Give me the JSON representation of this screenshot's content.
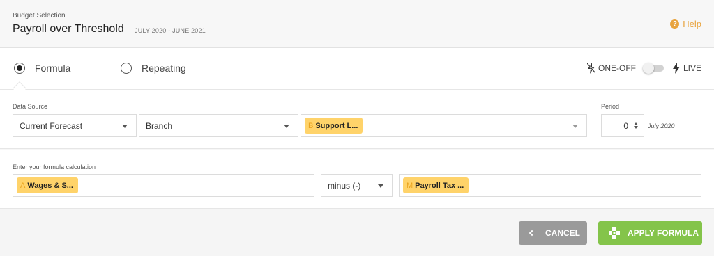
{
  "header": {
    "eyebrow": "Budget Selection",
    "title": "Payroll over Threshold",
    "subtitle": "JULY 2020 - JUNE 2021",
    "help_label": "Help",
    "help_icon": "question-circle-icon"
  },
  "modes": {
    "formula_label": "Formula",
    "repeating_label": "Repeating",
    "selected": "Formula"
  },
  "live_toggle": {
    "one_off_label": "ONE-OFF",
    "live_label": "LIVE",
    "state": "ONE-OFF"
  },
  "data_source": {
    "label": "Data Source",
    "source_value": "Current Forecast",
    "dimension_value": "Branch",
    "chip_letter": "B",
    "chip_label": "Support L..."
  },
  "period": {
    "label": "Period",
    "value": "0",
    "note": "July 2020"
  },
  "formula": {
    "label": "Enter your formula calculation",
    "left_letter": "A",
    "left_chip": "Wages & S...",
    "operator": "minus (-)",
    "right_letter": "M",
    "right_chip": "Payroll Tax ..."
  },
  "buttons": {
    "cancel": "CANCEL",
    "apply": "APPLY FORMULA"
  },
  "colors": {
    "accent_orange": "#e8a33d",
    "chip_yellow": "#ffd36a",
    "apply_green": "#84c44a",
    "cancel_gray": "#9a9a9a"
  }
}
